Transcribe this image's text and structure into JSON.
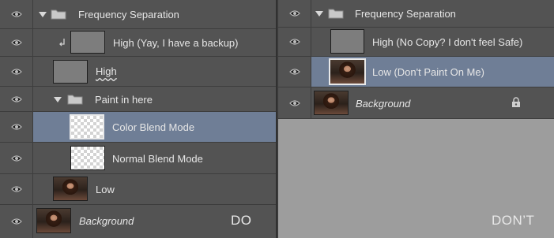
{
  "left_panel": {
    "caption": "DO",
    "layers": [
      {
        "label": "Frequency Separation"
      },
      {
        "label": "High (Yay, I have a backup)"
      },
      {
        "label": "High"
      },
      {
        "label": "Paint in here"
      },
      {
        "label": "Color Blend Mode"
      },
      {
        "label": "Normal Blend Mode"
      },
      {
        "label": "Low"
      },
      {
        "label": "Background"
      }
    ]
  },
  "right_panel": {
    "caption": "DON’T",
    "layers": [
      {
        "label": "Frequency Separation"
      },
      {
        "label": "High (No Copy? I don't feel Safe)"
      },
      {
        "label": "Low (Don't Paint On Me)"
      },
      {
        "label": "Background"
      }
    ]
  },
  "icons": {
    "eye": "eye-icon",
    "folder": "folder-icon",
    "caret": "disclosure-triangle-icon",
    "clip": "clipping-mask-arrow-icon",
    "lock": "lock-icon"
  },
  "colors": {
    "panel_bg": "#535353",
    "selected_row": "#6f7e96",
    "empty_area": "#9d9d9d",
    "text": "#e6e6e6"
  }
}
